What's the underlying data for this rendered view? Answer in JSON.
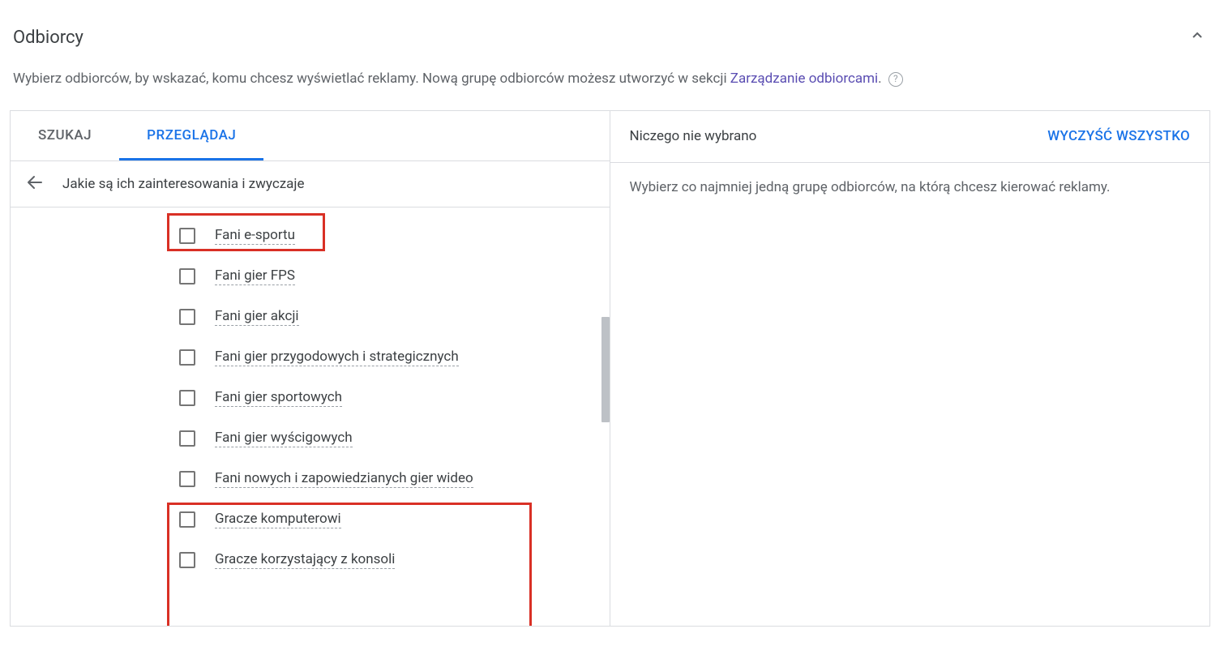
{
  "section": {
    "title": "Odbiorcy",
    "description_prefix": "Wybierz odbiorców, by wskazać, komu chcesz wyświetlać reklamy. Nową grupę odbiorców możesz utworzyć w sekcji ",
    "description_link": "Zarządzanie odbiorcami",
    "description_suffix": "."
  },
  "tabs": {
    "search": "SZUKAJ",
    "browse": "PRZEGLĄDAJ"
  },
  "breadcrumb": "Jakie są ich zainteresowania i zwyczaje",
  "audiences": [
    {
      "label": "Fani e-sportu"
    },
    {
      "label": "Fani gier FPS"
    },
    {
      "label": "Fani gier akcji"
    },
    {
      "label": "Fani gier przygodowych i strategicznych"
    },
    {
      "label": "Fani gier sportowych"
    },
    {
      "label": "Fani gier wyścigowych"
    },
    {
      "label": "Fani nowych i zapowiedzianych gier wideo"
    },
    {
      "label": "Gracze komputerowi"
    },
    {
      "label": "Gracze korzystający z konsoli"
    }
  ],
  "right": {
    "title": "Niczego nie wybrano",
    "clear": "WYCZYŚĆ WSZYSTKO",
    "body": "Wybierz co najmniej jedną grupę odbiorców, na którą chcesz kierować reklamy."
  }
}
